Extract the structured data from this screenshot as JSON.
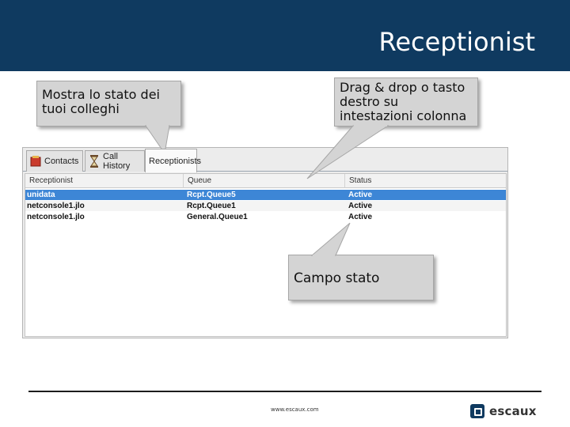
{
  "slide": {
    "title": "Receptionist"
  },
  "callouts": {
    "left": "Mostra lo stato dei tuoi colleghi",
    "right": "Drag & drop o tasto destro su intestazioni colonna",
    "bottom": "Campo stato"
  },
  "tabs": {
    "contacts": "Contacts",
    "call_history": "Call History",
    "receptionists": "Receptionists"
  },
  "table": {
    "columns": [
      "Receptionist",
      "Queue",
      "Status"
    ],
    "rows": [
      [
        "unidata",
        "Rcpt.Queue5",
        "Active"
      ],
      [
        "netconsole1.jlo",
        "Rcpt.Queue1",
        "Active"
      ],
      [
        "netconsole1.jlo",
        "General.Queue1",
        "Active"
      ]
    ]
  },
  "footer": {
    "url": "www.escaux.com",
    "brand": "escaux"
  },
  "colors": {
    "header_bg": "#0f3a60",
    "selection": "#3d86d6",
    "callout_bg": "#d4d4d4"
  }
}
